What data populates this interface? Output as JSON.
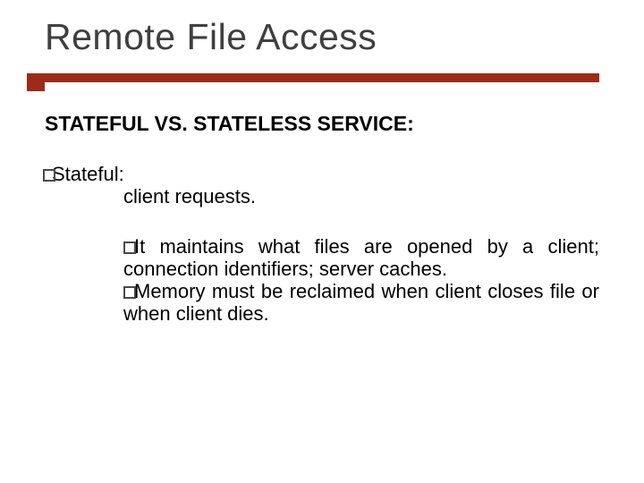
{
  "title": "Remote File Access",
  "subtitle": "STATEFUL VS. STATELESS SERVICE:",
  "stateful": {
    "label": "Stateful:",
    "line2": "client requests.",
    "items": [
      "It maintains what files are opened by a client; connection identifiers; server caches.",
      "Memory must be reclaimed when client closes file or when client dies."
    ]
  }
}
